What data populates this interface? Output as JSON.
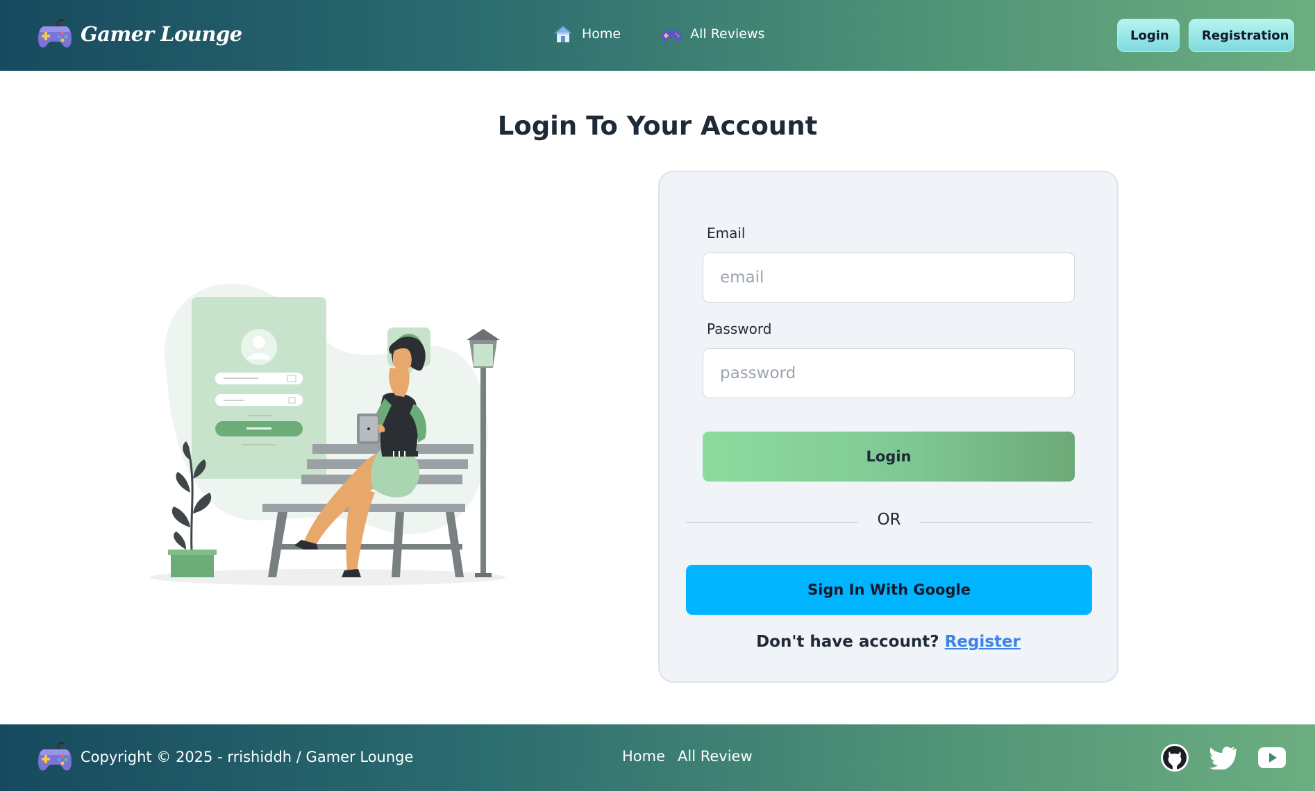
{
  "header": {
    "brand": "Gamer Lounge",
    "brand_icon": "gamepad-icon",
    "nav": [
      {
        "label": "Home",
        "icon": "home-icon"
      },
      {
        "label": "All Reviews",
        "icon": "gamepad-icon"
      }
    ],
    "login_label": "Login",
    "register_label": "Registration"
  },
  "main": {
    "title": "Login To Your Account",
    "illustration_icon": "login-illustration",
    "form": {
      "email_label": "Email",
      "email_placeholder": "email",
      "password_label": "Password",
      "password_placeholder": "password",
      "submit_label": "Login",
      "divider_text": "OR",
      "google_label": "Sign In With Google",
      "signup_prompt": "Don't have account?",
      "signup_link": "Register"
    }
  },
  "footer": {
    "copyright": "Copyright © 2025 - rrishiddh / Gamer Lounge",
    "links": [
      "Home",
      "All Review"
    ],
    "socials": [
      "github-icon",
      "twitter-icon",
      "youtube-icon"
    ]
  },
  "colors": {
    "header_gradient_start": "#174a5f",
    "header_gradient_end": "#6cae80",
    "login_button": "#8edb9e",
    "google_button": "#00b4ff",
    "register_link": "#3b82e6",
    "card_bg": "#f0f3f8"
  }
}
